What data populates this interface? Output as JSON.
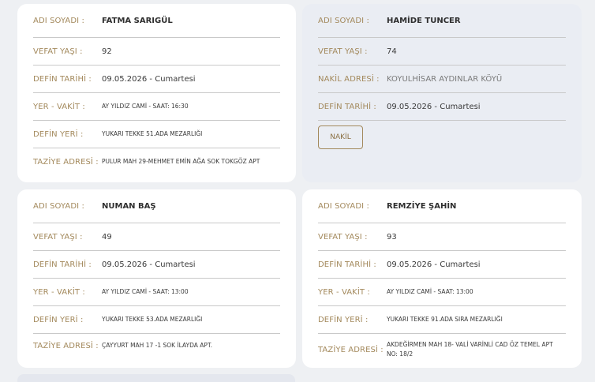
{
  "labels": {
    "name": "ADI SOYADI :",
    "age": "VEFAT YAŞI :",
    "burial_date": "DEFİN TARİHİ :",
    "place_time": "YER - VAKİT :",
    "burial_place": "DEFİN YERİ :",
    "condolence": "TAZİYE ADRESİ :",
    "transfer_address": "NAKİL ADRESİ :"
  },
  "cards": [
    {
      "name": "FATMA SARIGÜL",
      "age": "92",
      "burial_date": "09.05.2026 - Cumartesi",
      "place_time": "AY YILDIZ CAMİ - SAAT: 16:30",
      "burial_place": "YUKARI TEKKE 51.ADA MEZARLIĞI",
      "condolence": "PULUR MAH 29-MEHMET EMİN AĞA SOK TOKGÖZ APT"
    },
    {
      "name": "HAMİDE TUNCER",
      "age": "74",
      "transfer_address": "KOYULHİSAR AYDINLAR KÖYÜ",
      "burial_date": "09.05.2026 - Cumartesi",
      "button": "NAKİL"
    },
    {
      "name": "NUMAN BAŞ",
      "age": "49",
      "burial_date": "09.05.2026 - Cumartesi",
      "place_time": "AY YILDIZ CAMİ - SAAT: 13:00",
      "burial_place": "YUKARI TEKKE 53.ADA MEZARLIĞI",
      "condolence": "ÇAYYURT MAH 17 -1 SOK İLAYDA APT."
    },
    {
      "name": "REMZİYE ŞAHİN",
      "age": "93",
      "burial_date": "09.05.2026 - Cumartesi",
      "place_time": "AY YILDIZ CAMİ - SAAT: 13:00",
      "burial_place": "YUKARI TEKKE 91.ADA SIRA MEZARLIĞI",
      "condolence": "AKDEĞİRMEN MAH 18- VALİ VARİNLİ CAD ÖZ TEMEL APT NO: 18/2"
    }
  ]
}
